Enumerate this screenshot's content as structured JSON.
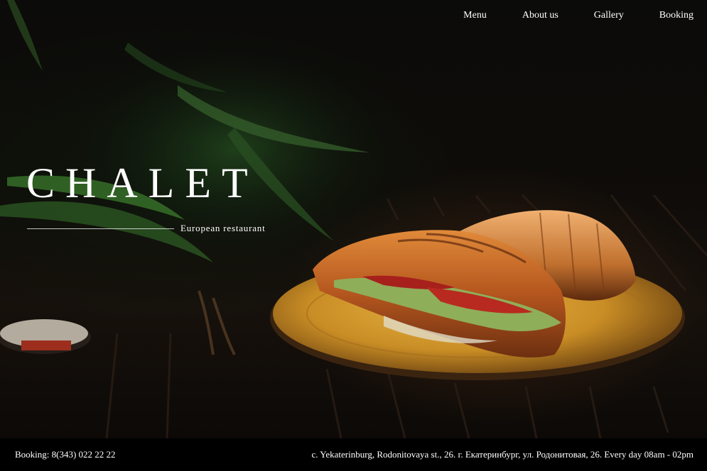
{
  "nav": {
    "items": [
      {
        "label": "Menu"
      },
      {
        "label": "About us"
      },
      {
        "label": "Gallery"
      },
      {
        "label": "Booking"
      }
    ]
  },
  "hero": {
    "title": "CHALET",
    "tagline": "European restaurant",
    "image": "croissant-sandwiches-on-plate"
  },
  "footer": {
    "booking": "Booking: 8(343) 022 22 22",
    "address": "c. Yekaterinburg, Rodonitovaya st., 26. г. Екатеринбург, ул. Родонитовая, 26. Every day 08am - 02pm"
  },
  "colors": {
    "background": "#0b0907",
    "text": "#ffffff",
    "footer": "#000000",
    "plate": "#d9a234",
    "pastry": "#c8742b"
  }
}
